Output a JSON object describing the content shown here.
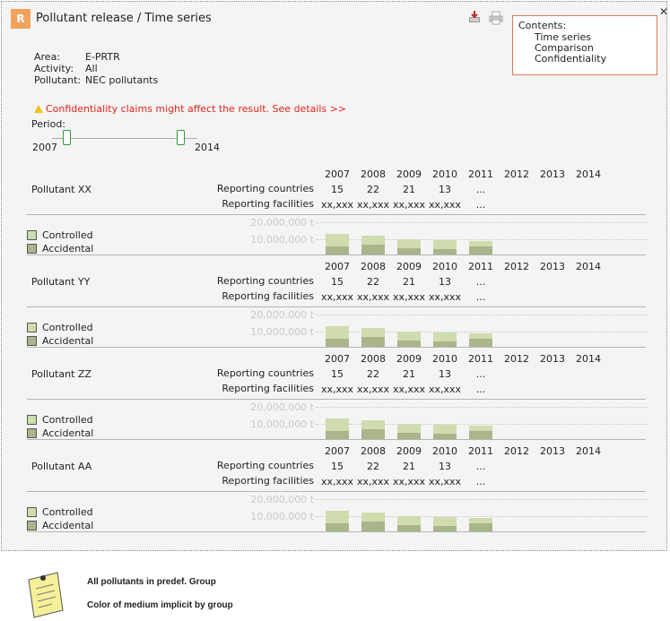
{
  "window": {
    "logo": "R",
    "title": "Pollutant release / Time series",
    "close": "✕"
  },
  "toolbar": {
    "pdf_icon": "pdf-icon",
    "print_icon": "print-icon"
  },
  "contents": {
    "heading": "Contents:",
    "items": [
      "Time series",
      "Comparison",
      "Confidentiality"
    ]
  },
  "meta": {
    "area_label": "Area:",
    "area": "E-PRTR",
    "activity_label": "Activity:",
    "activity": "All",
    "pollutant_label": "Pollutant:",
    "pollutant": "NEC pollutants"
  },
  "warning": "Confidentiality claims might affect the result. See details >>",
  "period": {
    "label": "Period:",
    "from": "2007",
    "to": "2014"
  },
  "years": [
    "2007",
    "2008",
    "2009",
    "2010",
    "2011",
    "2012",
    "2013",
    "2014"
  ],
  "labels": {
    "reporting_countries": "Reporting countries",
    "reporting_facilities": "Reporting facilities",
    "controlled": "Controlled",
    "accidental": "Accidental",
    "axis_high": "20,000,000 t",
    "axis_mid": "10,000,000 t"
  },
  "colors": {
    "controlled": "#cfdcae",
    "accidental": "#a9b58a",
    "accent": "#f0a25e",
    "warning": "#e2231a"
  },
  "chart_data": {
    "type": "bar",
    "categories": [
      "2007",
      "2008",
      "2009",
      "2010",
      "2011",
      "2012",
      "2013",
      "2014"
    ],
    "ylim": [
      0,
      25000000
    ],
    "ylabel_ticks": [
      "10,000,000 t",
      "20,000,000 t"
    ],
    "series": [
      {
        "name": "Controlled",
        "values": [
          7500000,
          5500000,
          5000000,
          5500000,
          3000000,
          null,
          null,
          null
        ]
      },
      {
        "name": "Accidental",
        "values": [
          4500000,
          6000000,
          3500000,
          3000000,
          4500000,
          null,
          null,
          null
        ]
      }
    ]
  },
  "pollutants": [
    {
      "name": "Pollutant XX",
      "countries": [
        "15",
        "22",
        "21",
        "13",
        "..."
      ],
      "facilities": [
        "xx,xxx",
        "xx,xxx",
        "xx,xxx",
        "xx,xxx",
        "..."
      ]
    },
    {
      "name": "Pollutant YY",
      "countries": [
        "15",
        "22",
        "21",
        "13",
        "..."
      ],
      "facilities": [
        "xx,xxx",
        "xx,xxx",
        "xx,xxx",
        "xx,xxx",
        "..."
      ]
    },
    {
      "name": "Pollutant ZZ",
      "countries": [
        "15",
        "22",
        "21",
        "13",
        "..."
      ],
      "facilities": [
        "xx,xxx",
        "xx,xxx",
        "xx,xxx",
        "xx,xxx",
        "..."
      ]
    },
    {
      "name": "Pollutant AA",
      "countries": [
        "15",
        "22",
        "21",
        "13",
        "..."
      ],
      "facilities": [
        "xx,xxx",
        "xx,xxx",
        "xx,xxx",
        "xx,xxx",
        "..."
      ]
    }
  ],
  "notes": [
    "All pollutants in predef. Group",
    "Color of medium implicit by group"
  ]
}
